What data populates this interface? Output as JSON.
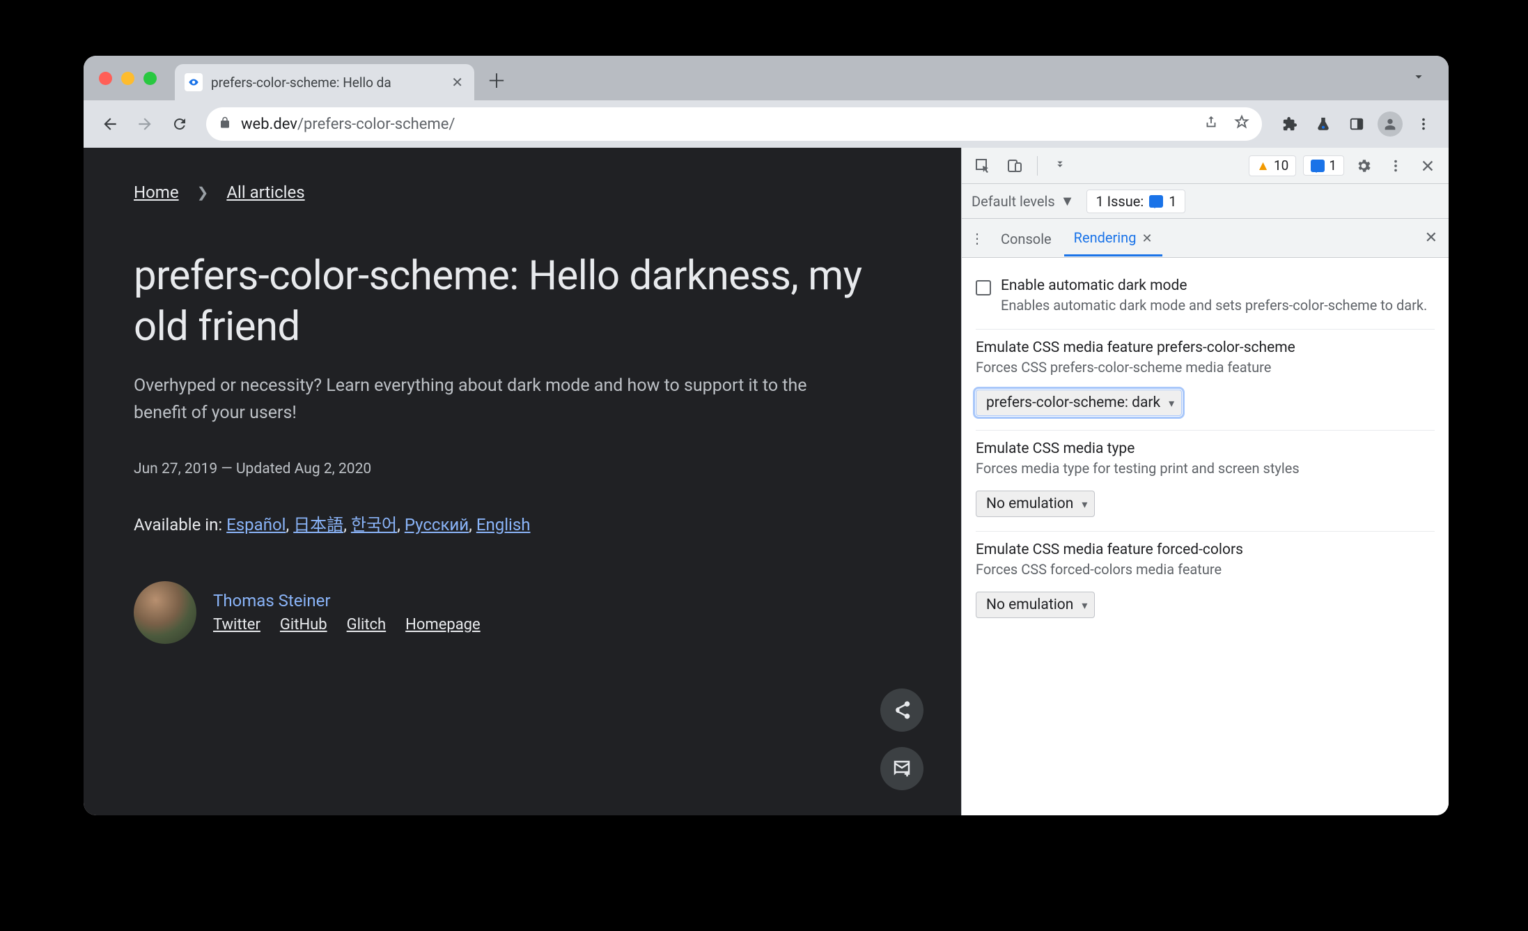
{
  "tab": {
    "title": "prefers-color-scheme: Hello da"
  },
  "url": {
    "domain": "web.dev",
    "path": "/prefers-color-scheme/"
  },
  "page": {
    "breadcrumb": {
      "home": "Home",
      "all": "All articles"
    },
    "title": "prefers-color-scheme: Hello darkness, my old friend",
    "subtitle": "Overhyped or necessity? Learn everything about dark mode and how to support it to the benefit of your users!",
    "dateline": "Jun 27, 2019 — Updated Aug 2, 2020",
    "available_label": "Available in: ",
    "languages": [
      "Español",
      "日本語",
      "한국어",
      "Русский",
      "English"
    ],
    "author": {
      "name": "Thomas Steiner",
      "links": [
        "Twitter",
        "GitHub",
        "Glitch",
        "Homepage"
      ]
    }
  },
  "devtools": {
    "warnings_count": "10",
    "messages_count": "1",
    "default_levels": "Default levels",
    "issue_label": "1 Issue:",
    "issue_count": "1",
    "tabs": {
      "console": "Console",
      "rendering": "Rendering"
    },
    "sections": {
      "darkmode": {
        "title": "Enable automatic dark mode",
        "desc": "Enables automatic dark mode and sets prefers-color-scheme to dark."
      },
      "pcs": {
        "title": "Emulate CSS media feature prefers-color-scheme",
        "desc": "Forces CSS prefers-color-scheme media feature",
        "value": "prefers-color-scheme: dark"
      },
      "mediatype": {
        "title": "Emulate CSS media type",
        "desc": "Forces media type for testing print and screen styles",
        "value": "No emulation"
      },
      "forcedcolors": {
        "title": "Emulate CSS media feature forced-colors",
        "desc": "Forces CSS forced-colors media feature",
        "value": "No emulation"
      }
    }
  }
}
